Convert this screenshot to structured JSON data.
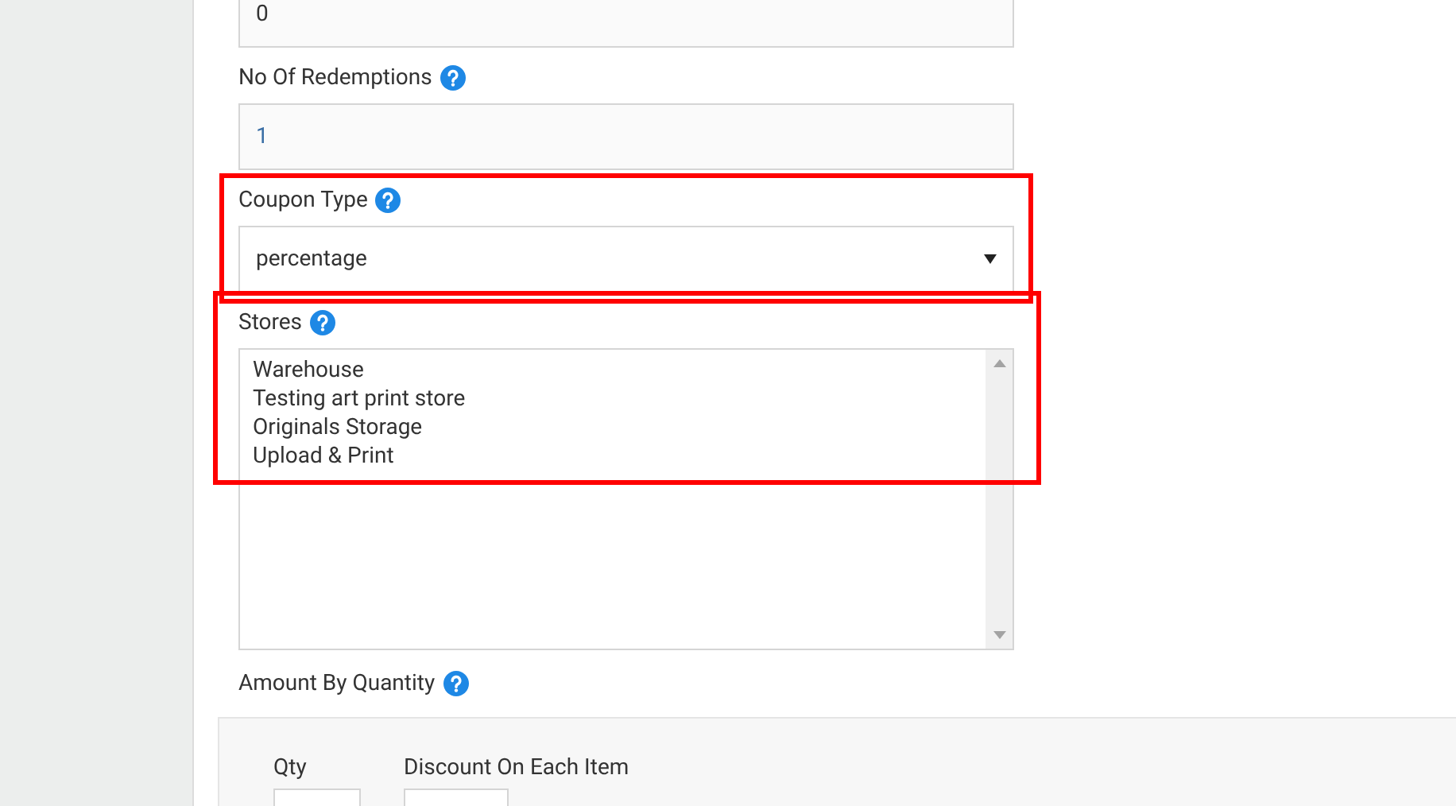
{
  "fields": [
    {
      "kind": "text",
      "value": "0",
      "highlighted": false
    },
    {
      "kind": "text",
      "label": "No Of Redemptions",
      "value": "1",
      "highlighted": false
    },
    {
      "kind": "select",
      "label": "Coupon Type",
      "value": "percentage",
      "highlighted": true
    },
    {
      "kind": "list",
      "label": "Stores",
      "options": [
        "Warehouse",
        "Testing art print store",
        "Originals Storage",
        "Upload & Print"
      ],
      "highlighted": true
    }
  ],
  "amount_by_quantity": {
    "label": "Amount By Quantity",
    "columns": [
      "Qty",
      "Discount On Each Item"
    ]
  }
}
